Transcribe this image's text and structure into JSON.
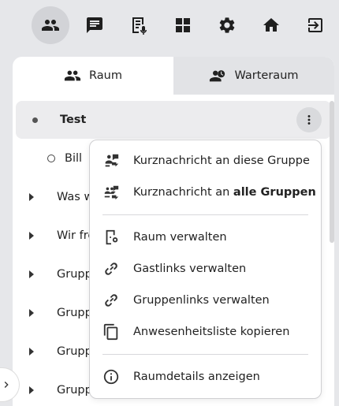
{
  "tabs": [
    {
      "label": "Raum",
      "icon": "group-icon",
      "active": true
    },
    {
      "label": "Warteraum",
      "icon": "waiting-room-icon",
      "active": false
    }
  ],
  "list": {
    "rows": [
      {
        "label": "Test",
        "kind": "room",
        "selected": true
      },
      {
        "label": "Bill",
        "kind": "participant"
      },
      {
        "label": "Was w",
        "kind": "group"
      },
      {
        "label": "Wir fre",
        "kind": "group"
      },
      {
        "label": "Grupp",
        "kind": "group"
      },
      {
        "label": "Grupp",
        "kind": "group"
      },
      {
        "label": "Grupp",
        "kind": "group"
      },
      {
        "label": "Grupp",
        "kind": "group"
      }
    ]
  },
  "menu": {
    "items": [
      {
        "label": "Kurznachricht an diese Gruppe",
        "icon": "group-message-icon"
      },
      {
        "label_prefix": "Kurznachricht an ",
        "label_bold": "alle Gruppen",
        "icon": "all-groups-message-icon"
      },
      {
        "label": "Raum verwalten",
        "icon": "manage-room-icon"
      },
      {
        "label": "Gastlinks verwalten",
        "icon": "link-icon"
      },
      {
        "label": "Gruppenlinks verwalten",
        "icon": "link-icon"
      },
      {
        "label": "Anwesenheitsliste kopieren",
        "icon": "copy-icon"
      },
      {
        "label": "Raumdetails anzeigen",
        "icon": "info-icon"
      }
    ]
  },
  "colors": {
    "background": "#e6e7ea",
    "panel": "#ffffff",
    "selected_row": "#ececee",
    "active_toolbar": "#d2d3d7"
  }
}
